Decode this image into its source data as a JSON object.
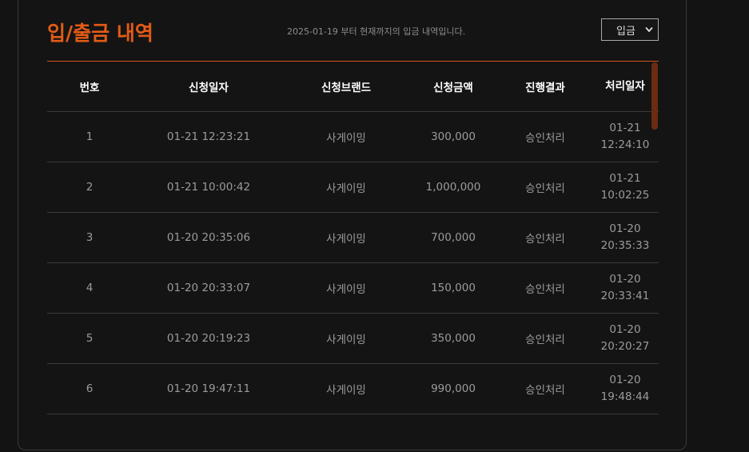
{
  "header": {
    "title": "입/출금 내역",
    "subtitle": "2025-01-19 부터 현재까지의 입금 내역입니다.",
    "filter_selected": "입금"
  },
  "colors": {
    "accent": "#e35b17",
    "background": "#131313",
    "divider": "#3a3a3a",
    "scrollbar": "#6b2c12"
  },
  "table": {
    "columns": [
      "번호",
      "신청일자",
      "신청브랜드",
      "신청금액",
      "진행결과",
      "처리일자"
    ],
    "rows": [
      {
        "no": "1",
        "date": "01-21 12:23:21",
        "brand": "사게이밍",
        "amount": "300,000",
        "result": "승인처리",
        "proc_date": "01-21",
        "proc_time": "12:24:10"
      },
      {
        "no": "2",
        "date": "01-21 10:00:42",
        "brand": "사게이밍",
        "amount": "1,000,000",
        "result": "승인처리",
        "proc_date": "01-21",
        "proc_time": "10:02:25"
      },
      {
        "no": "3",
        "date": "01-20 20:35:06",
        "brand": "사게이밍",
        "amount": "700,000",
        "result": "승인처리",
        "proc_date": "01-20",
        "proc_time": "20:35:33"
      },
      {
        "no": "4",
        "date": "01-20 20:33:07",
        "brand": "사게이밍",
        "amount": "150,000",
        "result": "승인처리",
        "proc_date": "01-20",
        "proc_time": "20:33:41"
      },
      {
        "no": "5",
        "date": "01-20 20:19:23",
        "brand": "사게이밍",
        "amount": "350,000",
        "result": "승인처리",
        "proc_date": "01-20",
        "proc_time": "20:20:27"
      },
      {
        "no": "6",
        "date": "01-20 19:47:11",
        "brand": "사게이밍",
        "amount": "990,000",
        "result": "승인처리",
        "proc_date": "01-20",
        "proc_time": "19:48:44"
      }
    ]
  }
}
